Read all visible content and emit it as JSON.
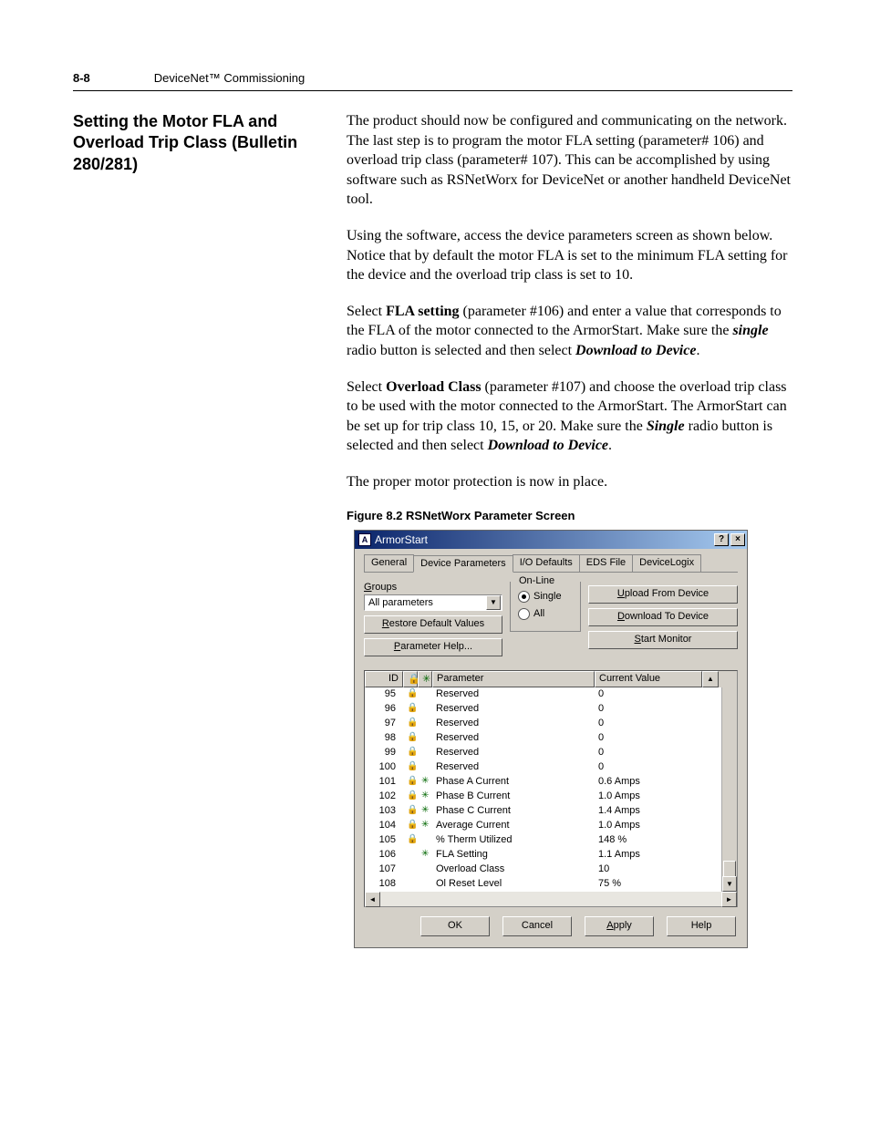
{
  "header": {
    "page_number": "8-8",
    "chapter": "DeviceNet™ Commissioning"
  },
  "section_title": "Setting the Motor FLA and Overload Trip Class (Bulletin 280/281)",
  "body": {
    "p1": "The product should now be configured and communicating on the network. The last step is to program the motor FLA setting (parameter# 106) and overload trip class (parameter# 107). This can be accomplished by using software such as RSNetWorx for DeviceNet or another handheld DeviceNet tool.",
    "p2": "Using the software, access the device parameters screen as shown below. Notice that by default the motor FLA is set to the minimum FLA setting for the device and the overload trip class is set to 10.",
    "p3a": "Select ",
    "p3b": "FLA setting",
    "p3c": " (parameter #106) and enter a value that corresponds to the FLA of the motor connected to the ArmorStart. Make sure the ",
    "p3d": "single",
    "p3e": " radio button is selected and then select ",
    "p3f": "Download to Device",
    "p3g": ".",
    "p4a": "Select ",
    "p4b": "Overload Class",
    "p4c": " (parameter #107) and choose the overload trip class to be used with the motor connected to the ArmorStart. The ArmorStart can be set up for trip class 10, 15, or 20. Make sure the ",
    "p4d": "Single",
    "p4e": " radio button is selected and then select ",
    "p4f": "Download to Device",
    "p4g": ".",
    "p5": "The proper motor protection is now in place."
  },
  "figure_caption": "Figure 8.2   RSNetWorx Parameter Screen",
  "dialog": {
    "title": "ArmorStart",
    "tabs": [
      "General",
      "Device Parameters",
      "I/O Defaults",
      "EDS File",
      "DeviceLogix"
    ],
    "groups_label": "Groups",
    "combo_value": "All parameters",
    "restore_btn": "Restore Default Values",
    "help_btn": "Parameter Help...",
    "online_legend": "On-Line",
    "radio_single": "Single",
    "radio_all": "All",
    "upload_btn": "Upload From Device",
    "download_btn": "Download To Device",
    "monitor_btn": "Start Monitor",
    "columns": {
      "id": "ID",
      "param": "Parameter",
      "cv": "Current Value"
    },
    "rows": [
      {
        "id": "95",
        "f1": "🔒",
        "f2": "",
        "param": "Reserved",
        "cv": "0"
      },
      {
        "id": "96",
        "f1": "🔒",
        "f2": "",
        "param": "Reserved",
        "cv": "0"
      },
      {
        "id": "97",
        "f1": "🔒",
        "f2": "",
        "param": "Reserved",
        "cv": "0"
      },
      {
        "id": "98",
        "f1": "🔒",
        "f2": "",
        "param": "Reserved",
        "cv": "0"
      },
      {
        "id": "99",
        "f1": "🔒",
        "f2": "",
        "param": "Reserved",
        "cv": "0"
      },
      {
        "id": "100",
        "f1": "🔒",
        "f2": "",
        "param": "Reserved",
        "cv": "0"
      },
      {
        "id": "101",
        "f1": "🔒",
        "f2": "✳",
        "param": "Phase A Current",
        "cv": "0.6 Amps"
      },
      {
        "id": "102",
        "f1": "🔒",
        "f2": "✳",
        "param": "Phase B Current",
        "cv": "1.0 Amps"
      },
      {
        "id": "103",
        "f1": "🔒",
        "f2": "✳",
        "param": "Phase C Current",
        "cv": "1.4 Amps"
      },
      {
        "id": "104",
        "f1": "🔒",
        "f2": "✳",
        "param": "Average Current",
        "cv": "1.0 Amps"
      },
      {
        "id": "105",
        "f1": "🔒",
        "f2": "",
        "param": "% Therm Utilized",
        "cv": "148 %"
      },
      {
        "id": "106",
        "f1": "",
        "f2": "✳",
        "param": "FLA Setting",
        "cv": "1.1 Amps"
      },
      {
        "id": "107",
        "f1": "",
        "f2": "",
        "param": "Overload Class",
        "cv": "10"
      },
      {
        "id": "108",
        "f1": "",
        "f2": "",
        "param": "Ol Reset Level",
        "cv": "75 %"
      }
    ],
    "buttons": {
      "ok": "OK",
      "cancel": "Cancel",
      "apply": "Apply",
      "help": "Help"
    }
  }
}
